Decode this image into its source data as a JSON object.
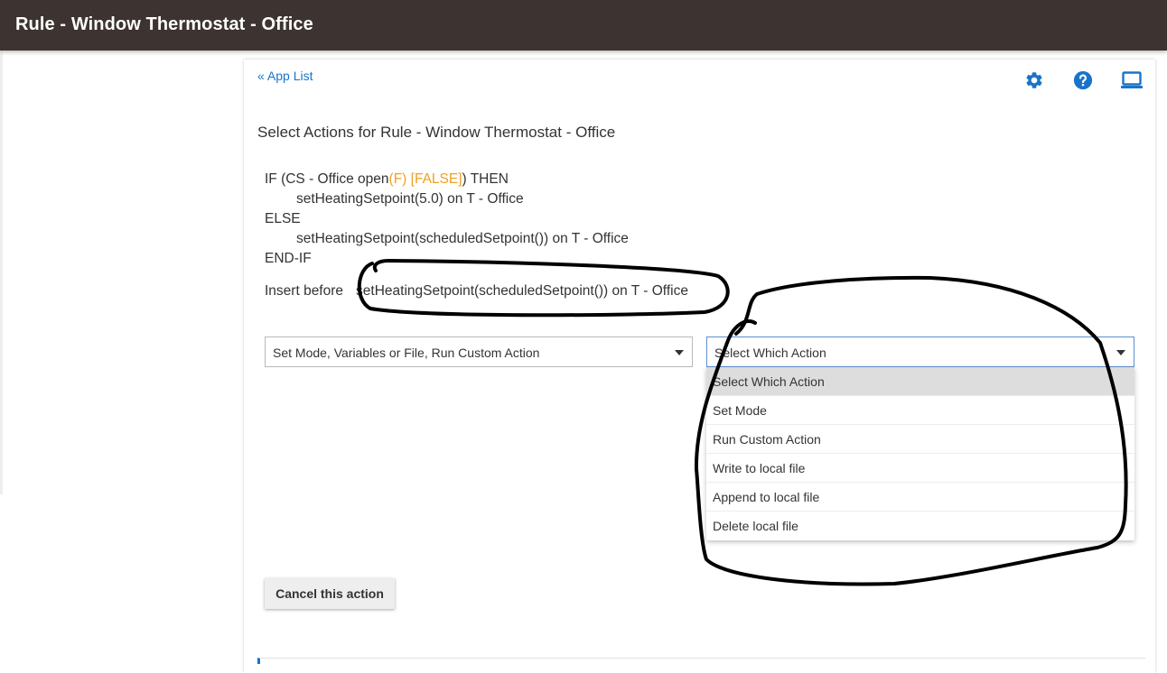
{
  "header": {
    "title": "Rule - Window Thermostat - Office"
  },
  "nav": {
    "app_list": "« App List"
  },
  "toolbar": {
    "settings_icon": "gear-icon",
    "help_icon": "help-icon",
    "display_icon": "laptop-icon"
  },
  "page": {
    "title": "Select Actions for Rule - Window Thermostat - Office"
  },
  "rule": {
    "if_prefix": "IF (CS - Office open",
    "if_state": "(F) [FALSE]",
    "if_suffix": ") THEN",
    "then_action": "setHeatingSetpoint(5.0) on T - Office",
    "else": "ELSE",
    "else_action": "setHeatingSetpoint(scheduledSetpoint()) on T - Office",
    "end": "END-IF"
  },
  "insert": {
    "label": "Insert before",
    "target": "setHeatingSetpoint(scheduledSetpoint()) on T - Office"
  },
  "category_select": {
    "value": "Set Mode, Variables or File, Run Custom Action"
  },
  "action_select": {
    "value": "Select Which Action",
    "options": [
      "Select Which Action",
      "Set Mode",
      "Run Custom Action",
      "Write to local file",
      "Append to local file",
      "Delete local file"
    ]
  },
  "buttons": {
    "cancel": "Cancel this action"
  },
  "colors": {
    "header_bg": "#3d3330",
    "link": "#1a73c9",
    "state_highlight": "#f0a020"
  }
}
